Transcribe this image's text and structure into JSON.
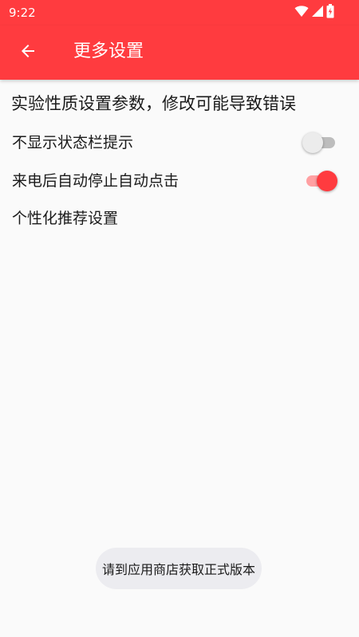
{
  "status_bar": {
    "time": "9:22",
    "icons": [
      "wifi-icon",
      "signal-icon",
      "battery-charging-icon"
    ]
  },
  "app_bar": {
    "back_icon": "arrow-left-icon",
    "title": "更多设置"
  },
  "warning": "实验性质设置参数，修改可能导致错误",
  "settings": [
    {
      "label": "不显示状态栏提示",
      "toggle": false
    },
    {
      "label": "来电后自动停止自动点击",
      "toggle": true
    },
    {
      "label": "个性化推荐设置"
    }
  ],
  "toast": "请到应用商店获取正式版本",
  "colors": {
    "primary": "#ff3b3f",
    "primary_light": "#ffa0a2",
    "background": "#fafafa",
    "toast_bg": "#ececf0"
  }
}
